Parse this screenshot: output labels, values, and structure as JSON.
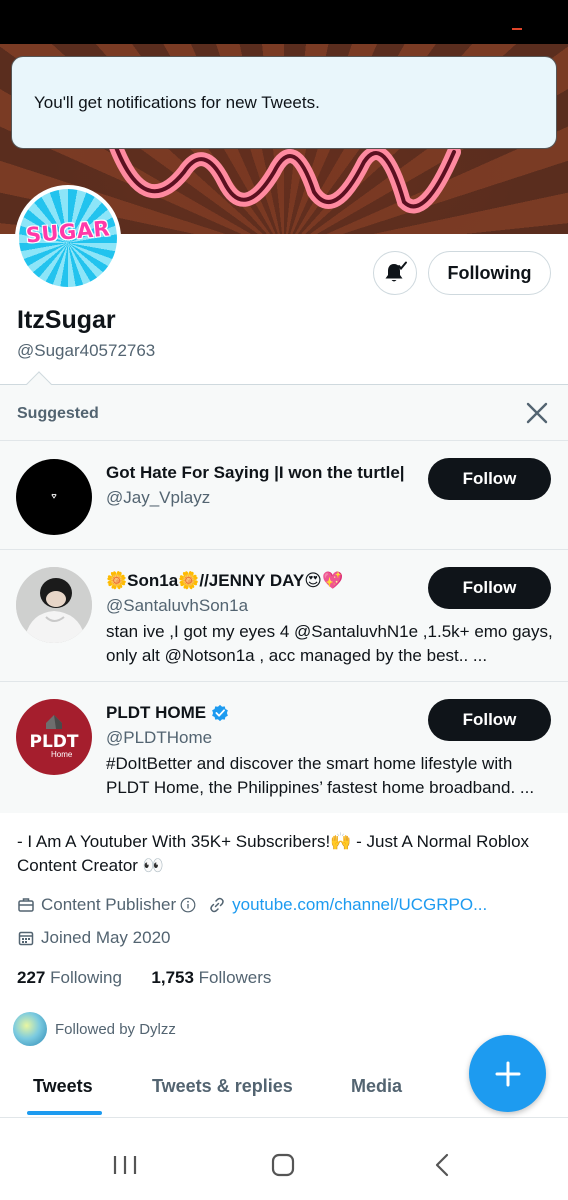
{
  "toast": {
    "text": "You'll get notifications for new Tweets."
  },
  "profile": {
    "avatar_text": "SUGAR",
    "name": "ItzSugar",
    "handle": "@Sugar40572763",
    "following_button": "Following",
    "bio": "- I Am A Youtuber With 35K+ Subscribers!🙌 - Just A Normal Roblox Content Creator 👀",
    "category": "Content Publisher",
    "link": "youtube.com/channel/UCGRPO...",
    "joined": "Joined May 2020",
    "following_count": "227",
    "following_label": "Following",
    "followers_count": "1,753",
    "followers_label": "Followers",
    "followed_by": "Followed by Dylzz"
  },
  "suggested": {
    "heading": "Suggested",
    "follow_label": "Follow",
    "items": [
      {
        "name": "Got Hate For Saying |I won the turtle|",
        "handle": "@Jay_Vplayz",
        "bio": ""
      },
      {
        "name": "🌼Son1a🌼//JENNY DAY😍💖",
        "handle": "@SantaluvhSon1a",
        "bio": "stan ive ,I got my eyes 4 @SantaluvhN1e  ,1.5k+ emo gays, only alt @Notson1a ,  acc managed by the best.. ..."
      },
      {
        "name": "PLDT HOME",
        "handle": "@PLDTHome",
        "bio": "#DoItBetter and discover the smart home lifestyle with PLDT Home, the Philippines’ fastest home broadband. ...",
        "avatar_text": "PLDT",
        "avatar_sub": "Home"
      }
    ]
  },
  "tabs": [
    "Tweets",
    "Tweets & replies",
    "Media"
  ],
  "colors": {
    "accent": "#1d9bf0",
    "text": "#0f1419",
    "muted": "#536471",
    "toast_bg": "#e9f6fb",
    "pldt_red": "#a51e2d"
  }
}
